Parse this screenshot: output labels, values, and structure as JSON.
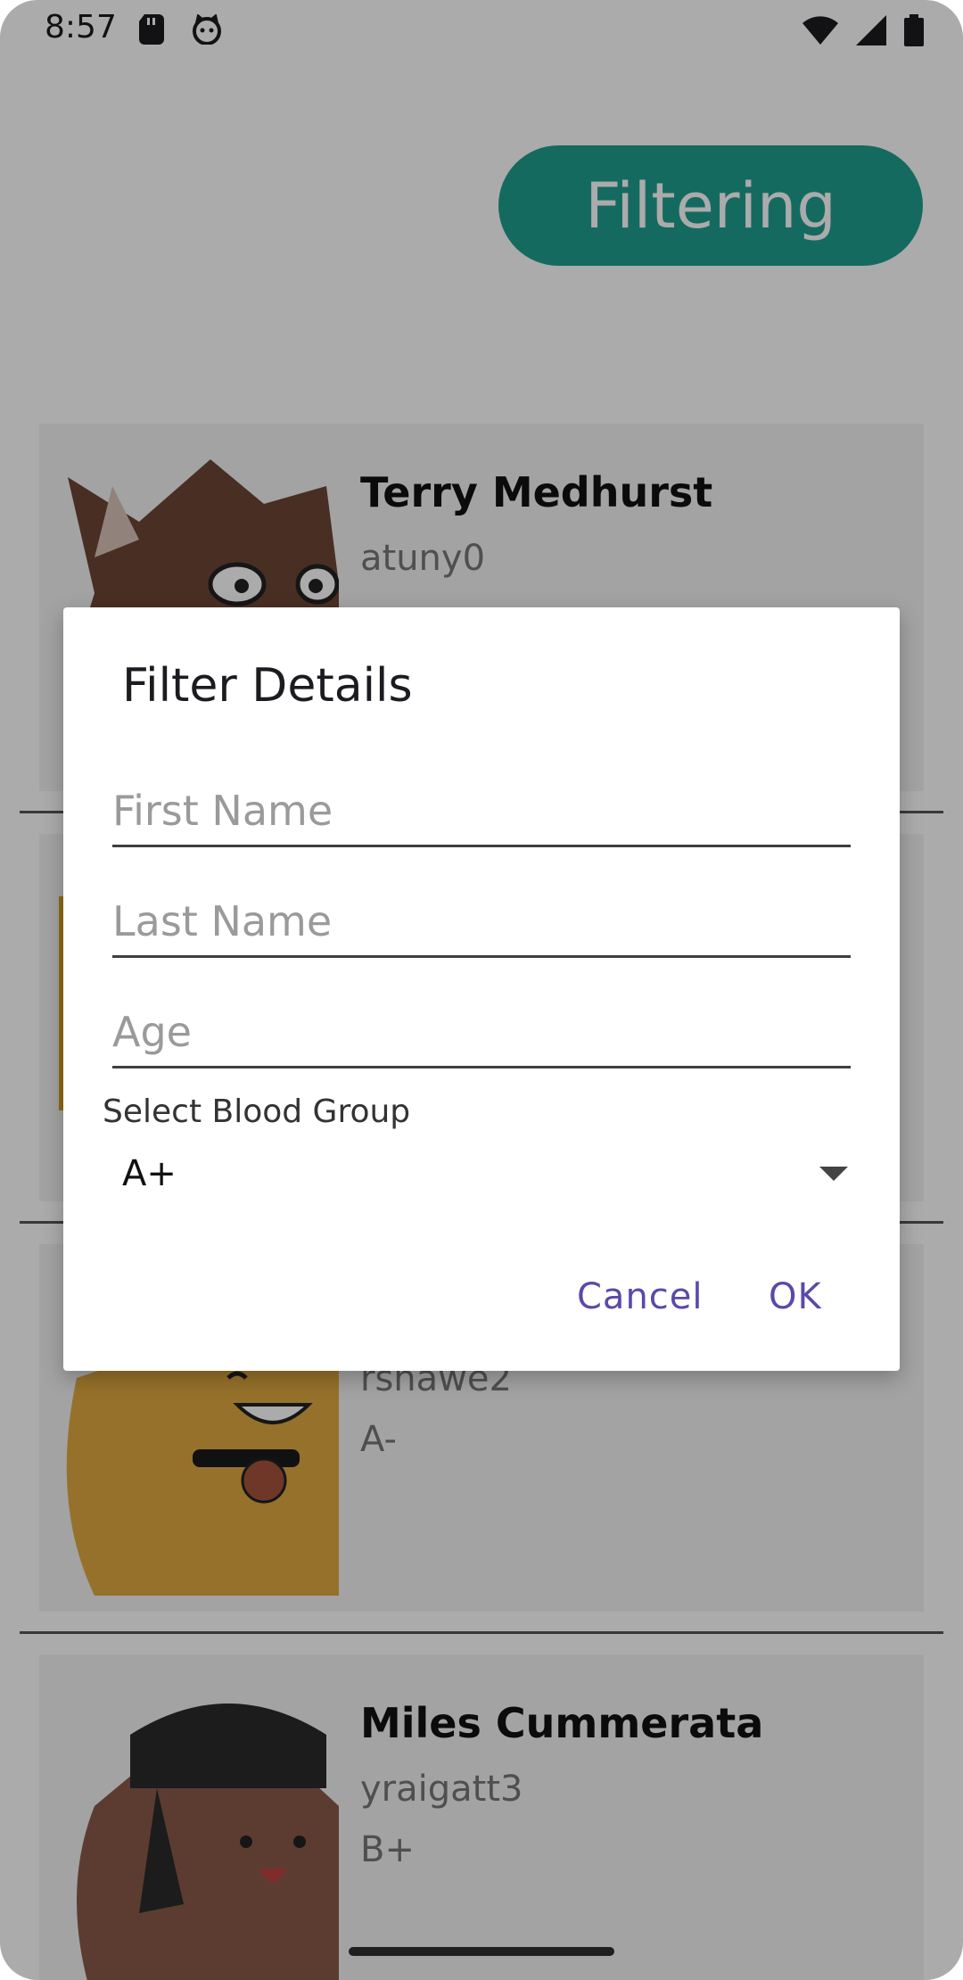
{
  "status_bar": {
    "time": "8:57",
    "left_icons": [
      "sd-card-icon",
      "cat-face-icon"
    ],
    "right_icons": [
      "wifi-icon",
      "signal-icon",
      "battery-icon"
    ]
  },
  "filter_button": {
    "label": "Filtering",
    "color": "#209e90"
  },
  "list": {
    "items": [
      {
        "name": "Terry Medhurst",
        "username": "atuny0",
        "blood": ""
      },
      {
        "name": "",
        "username": "",
        "blood": ""
      },
      {
        "name": "",
        "username": "rshawe2",
        "blood": "A-"
      },
      {
        "name": "Miles Cummerata",
        "username": "yraigatt3",
        "blood": "B+"
      }
    ]
  },
  "dialog": {
    "title": "Filter Details",
    "first_name": {
      "placeholder": "First Name",
      "value": ""
    },
    "last_name": {
      "placeholder": "Last Name",
      "value": ""
    },
    "age": {
      "placeholder": "Age",
      "value": ""
    },
    "blood_group_label": "Select Blood Group",
    "blood_group_selected": "A+",
    "cancel_label": "Cancel",
    "ok_label": "OK",
    "accent_color": "#5a4aa8"
  }
}
